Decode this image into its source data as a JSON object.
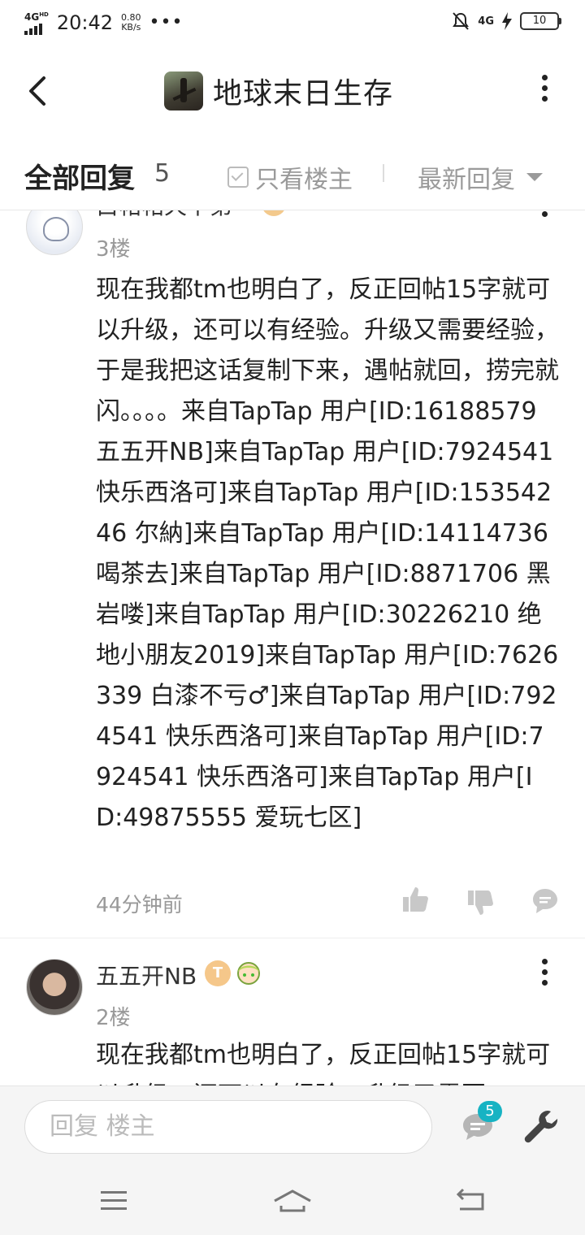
{
  "status_bar": {
    "network": "4G",
    "network_sup": "HD",
    "time": "20:42",
    "speed_value": "0.80",
    "speed_unit": "KB/s",
    "dots": "•••",
    "right_network": "4G",
    "battery": "10"
  },
  "header": {
    "title": "地球末日生存"
  },
  "sort_bar": {
    "all_replies": "全部回复",
    "count": "5",
    "only_op": "只看楼主",
    "sort": "最新回复"
  },
  "posts": [
    {
      "name": "白帖帖天下第一",
      "floor": "3楼",
      "body": "现在我都tm也明白了，反正回帖15字就可以升级，还可以有经验。升级又需要经验，于是我把这话复制下来，遇帖就回，捞完就闪。。。。来自TapTap 用户[ID:16188579 五五开NB]来自TapTap 用户[ID:7924541 快乐西洛可]来自TapTap 用户[ID:15354246 尔納]来自TapTap 用户[ID:14114736 喝茶去]来自TapTap 用户[ID:8871706 黑岩喽]来自TapTap 用户[ID:30226210 绝地小朋友2019]来自TapTap 用户[ID:7626339 白漆不亏♂]来自TapTap 用户[ID:7924541 快乐西洛可]来自TapTap 用户[ID:7924541 快乐西洛可]来自TapTap 用户[ID:49875555 爱玩七区]",
      "time": "44分钟前"
    },
    {
      "name": "五五开NB",
      "badge": "T",
      "floor": "2楼",
      "body": "现在我都tm也明白了，反正回帖15字就可以升级，还可以有经验。升级又需要"
    }
  ],
  "input": {
    "placeholder": "回复  楼主"
  },
  "messages_badge": "5",
  "colors": {
    "accent": "#17b3c3",
    "icon_gray": "#c8c8c8",
    "text_gray": "#999999"
  }
}
